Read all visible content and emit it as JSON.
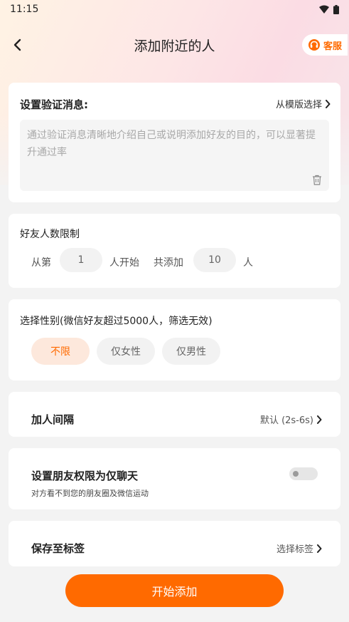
{
  "status_bar": {
    "time": "11:15"
  },
  "nav": {
    "title": "添加附近的人",
    "service_label": "客服"
  },
  "verify": {
    "title": "设置验证消息:",
    "template_link": "从模版选择",
    "placeholder": "通过验证消息清晰地介绍自己或说明添加好友的目的，可以显著提升通过率"
  },
  "limit": {
    "title": "好友人数限制",
    "from_label": "从第",
    "from_value": "1",
    "start_label": "人开始",
    "total_label": "共添加",
    "total_value": "10",
    "unit": "人"
  },
  "gender": {
    "title": "选择性别(微信好友超过5000人，筛选无效)",
    "options": [
      "不限",
      "仅女性",
      "仅男性"
    ],
    "selected": "不限"
  },
  "interval": {
    "title": "加人间隔",
    "value": "默认 (2s-6s)"
  },
  "privacy": {
    "title": "设置朋友权限为仅聊天",
    "subtitle": "对方看不到您的朋友圈及微信运动",
    "enabled": false
  },
  "tag": {
    "title": "保存至标签",
    "value": "选择标签"
  },
  "action": {
    "start_label": "开始添加"
  },
  "colors": {
    "accent": "#ff6a00",
    "active_pill_bg": "#fde8dc"
  }
}
